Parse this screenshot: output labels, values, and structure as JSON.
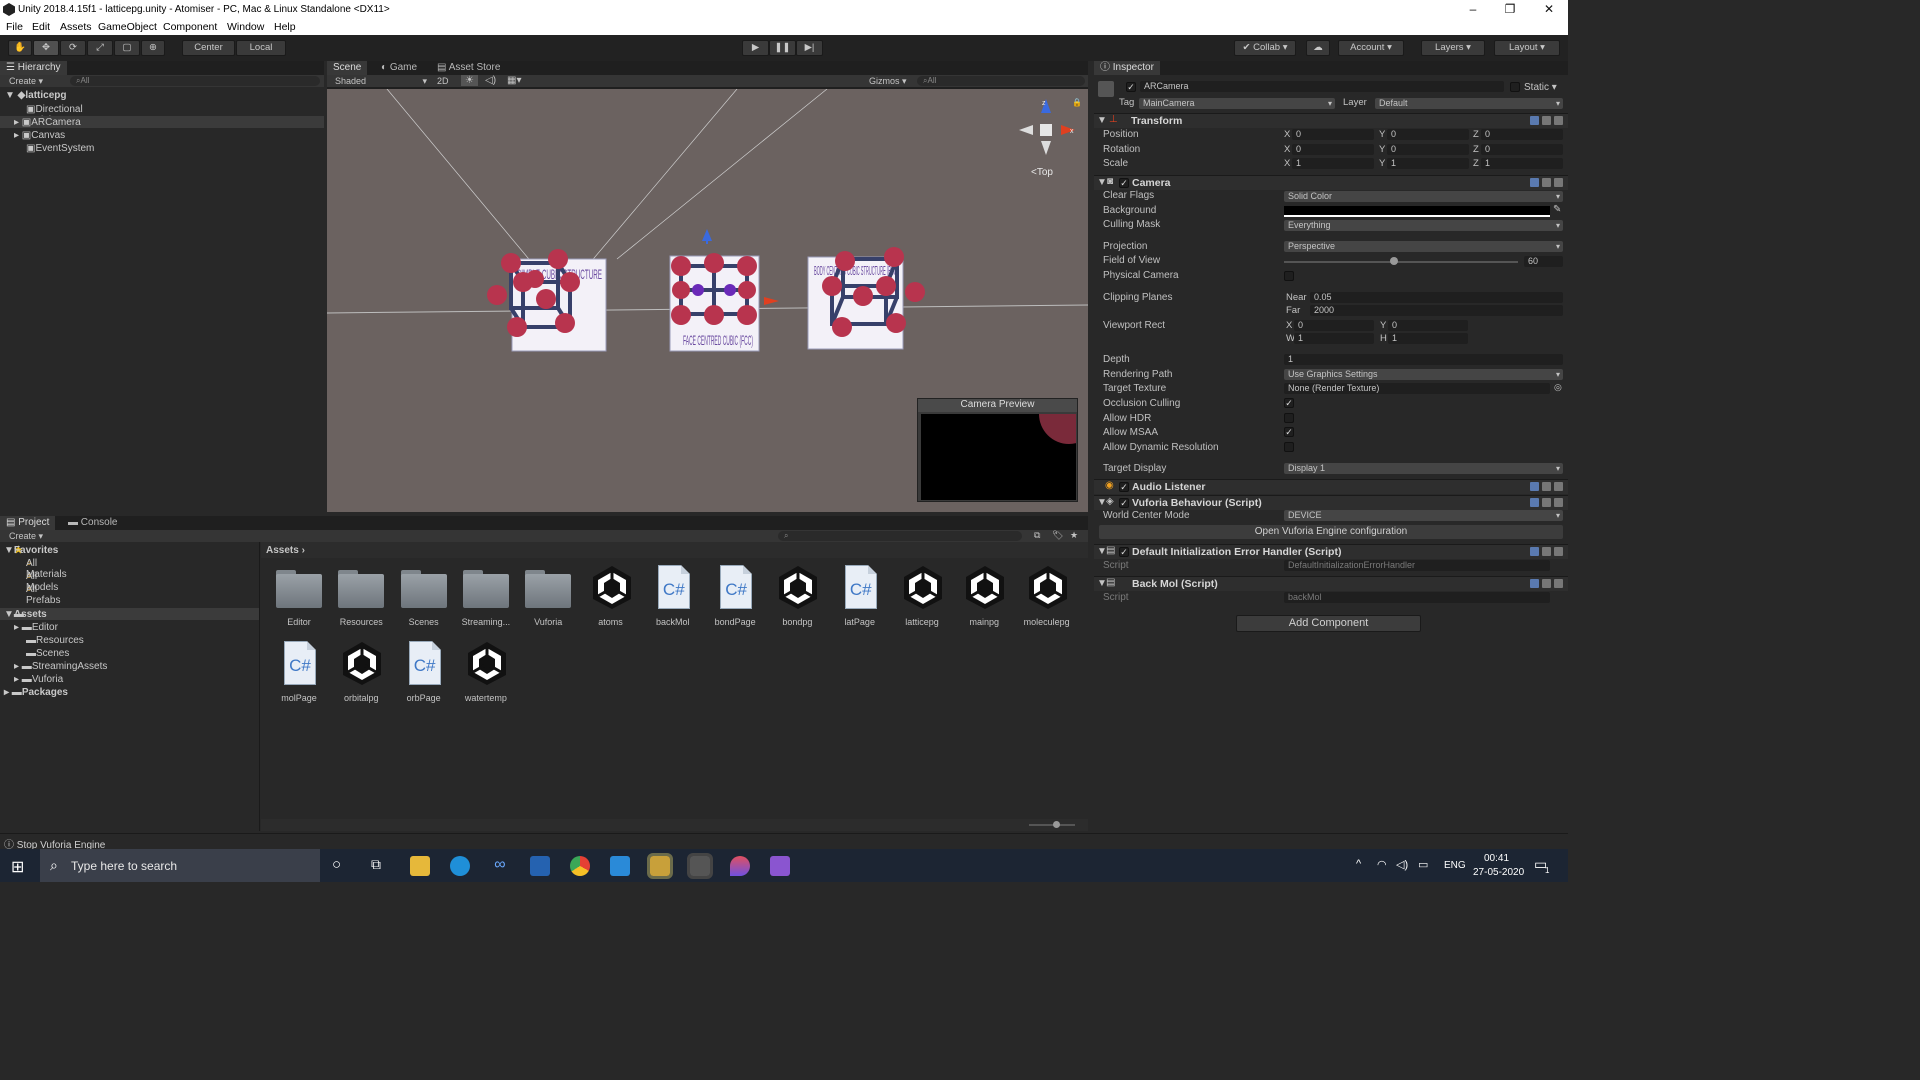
{
  "window": {
    "title": "Unity 2018.4.15f1 - latticepg.unity - Atomiser - PC, Mac & Linux Standalone <DX11>"
  },
  "menu": [
    "File",
    "Edit",
    "Assets",
    "GameObject",
    "Component",
    "Window",
    "Help"
  ],
  "toolbar": {
    "center": "Center",
    "local": "Local",
    "collab": "Collab",
    "account": "Account",
    "layers": "Layers",
    "layout": "Layout"
  },
  "hierarchy": {
    "tab": "Hierarchy",
    "create": "Create",
    "search": "All",
    "scene": "latticepg",
    "items": [
      "Directional Light",
      "ARCamera",
      "Canvas",
      "EventSystem"
    ]
  },
  "scene_tabs": {
    "scene": "Scene",
    "game": "Game",
    "asset_store": "Asset Store",
    "shaded": "Shaded",
    "mode2d": "2D",
    "gizmos": "Gizmos",
    "search": "All",
    "gizmo_view": "Top",
    "preview": "Camera Preview"
  },
  "scene_cards": [
    {
      "text": "SIMPLE CUBIC STRUCTURE"
    },
    {
      "text": "FACE CENTRED CUBIC (FCC)"
    },
    {
      "text": "BODY CENTRED CUBIC STRUCTURE (BCC)"
    }
  ],
  "inspector": {
    "tab": "Inspector",
    "object": "ARCamera",
    "static": "Static",
    "tag_label": "Tag",
    "tag": "MainCamera",
    "layer_label": "Layer",
    "layer": "Default",
    "transform": {
      "title": "Transform",
      "rows": [
        {
          "label": "Position",
          "x": "0",
          "y": "0",
          "z": "0"
        },
        {
          "label": "Rotation",
          "x": "0",
          "y": "0",
          "z": "0"
        },
        {
          "label": "Scale",
          "x": "1",
          "y": "1",
          "z": "1"
        }
      ]
    },
    "camera": {
      "title": "Camera",
      "clear_flags_l": "Clear Flags",
      "clear_flags": "Solid Color",
      "background_l": "Background",
      "culling_mask_l": "Culling Mask",
      "culling_mask": "Everything",
      "projection_l": "Projection",
      "projection": "Perspective",
      "fov_l": "Field of View",
      "fov": "60",
      "fov_fraction": 0.47,
      "physical_l": "Physical Camera",
      "clipping_l": "Clipping Planes",
      "near_l": "Near",
      "near": "0.05",
      "far_l": "Far",
      "far": "2000",
      "viewport_l": "Viewport Rect",
      "vx": "0",
      "vy": "0",
      "vw": "1",
      "vh": "1",
      "depth_l": "Depth",
      "depth": "1",
      "rendering_l": "Rendering Path",
      "rendering": "Use Graphics Settings",
      "target_texture_l": "Target Texture",
      "target_texture": "None (Render Texture)",
      "occlusion_l": "Occlusion Culling",
      "hdr_l": "Allow HDR",
      "msaa_l": "Allow MSAA",
      "dynres_l": "Allow Dynamic Resolution",
      "display_l": "Target Display",
      "display": "Display 1"
    },
    "audio": "Audio Listener",
    "vuforia": {
      "title": "Vuforia Behaviour (Script)",
      "wcm_l": "World Center Mode",
      "wcm": "DEVICE",
      "open": "Open Vuforia Engine configuration"
    },
    "default_init": {
      "title": "Default Initialization Error Handler (Script)",
      "script_l": "Script",
      "script": "DefaultInitializationErrorHandler"
    },
    "backmol": {
      "title": "Back Mol (Script)",
      "script_l": "Script",
      "script": "backMol"
    },
    "add_component": "Add Component"
  },
  "project": {
    "tab": "Project",
    "console": "Console",
    "create": "Create",
    "favorites": "Favorites",
    "fav_items": [
      "All Materials",
      "All Models",
      "All Prefabs"
    ],
    "assets": "Assets",
    "asset_folders": [
      "Editor",
      "Resources",
      "Scenes",
      "StreamingAssets",
      "Vuforia"
    ],
    "packages": "Packages",
    "breadcrumb": "Assets",
    "grid": [
      {
        "name": "Editor",
        "kind": "folder"
      },
      {
        "name": "Resources",
        "kind": "folder"
      },
      {
        "name": "Scenes",
        "kind": "folder"
      },
      {
        "name": "Streaming...",
        "kind": "folder"
      },
      {
        "name": "Vuforia",
        "kind": "folder"
      },
      {
        "name": "atoms",
        "kind": "unity"
      },
      {
        "name": "backMol",
        "kind": "cs"
      },
      {
        "name": "bondPage",
        "kind": "cs"
      },
      {
        "name": "bondpg",
        "kind": "unity"
      },
      {
        "name": "latPage",
        "kind": "cs"
      },
      {
        "name": "latticepg",
        "kind": "unity"
      },
      {
        "name": "mainpg",
        "kind": "unity"
      },
      {
        "name": "moleculepg",
        "kind": "unity"
      },
      {
        "name": "molPage",
        "kind": "cs"
      },
      {
        "name": "orbitalpg",
        "kind": "unity"
      },
      {
        "name": "orbPage",
        "kind": "cs"
      },
      {
        "name": "watertemp",
        "kind": "unity"
      }
    ]
  },
  "status": "Stop Vuforia Engine",
  "taskbar": {
    "search": "Type here to search",
    "lang": "ENG",
    "time": "00:41",
    "date": "27-05-2020",
    "notif": "1"
  }
}
